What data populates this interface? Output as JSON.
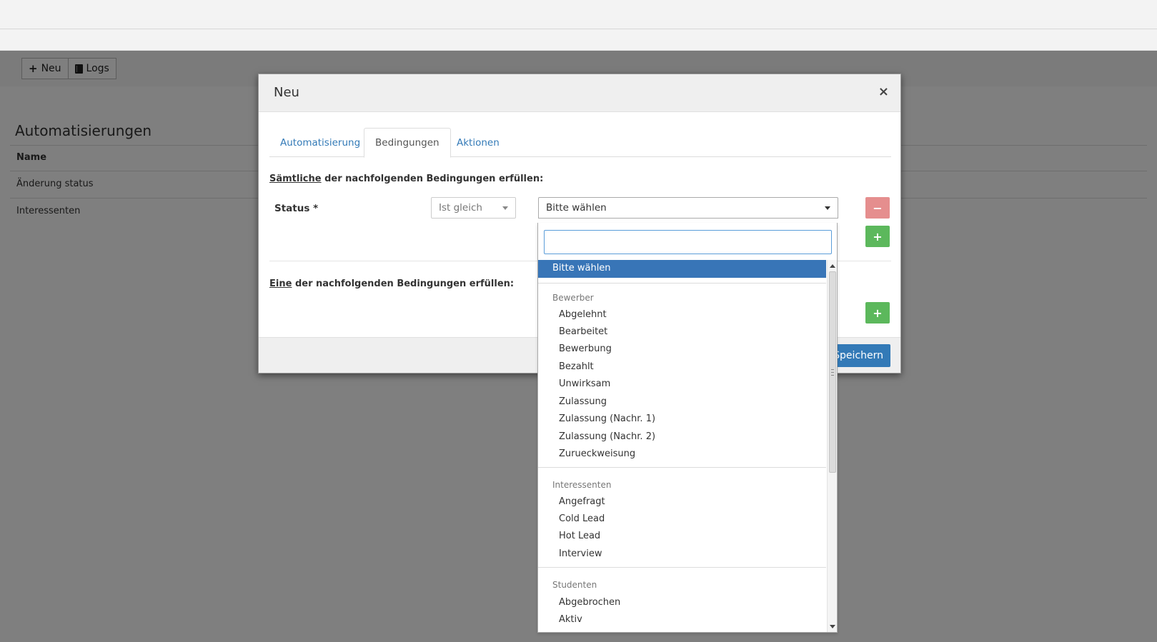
{
  "toolbar": {
    "new_label": "Neu",
    "logs_label": "Logs"
  },
  "page": {
    "title": "Automatisierungen",
    "table": {
      "header": "Name",
      "rows": [
        "Änderung status",
        "Interessenten"
      ]
    }
  },
  "modal": {
    "title": "Neu",
    "close": "×",
    "tabs": [
      {
        "label": "Automatisierung",
        "active": false
      },
      {
        "label": "Bedingungen",
        "active": true
      },
      {
        "label": "Aktionen",
        "active": false
      }
    ],
    "all_conditions": {
      "keyword": "Sämtliche",
      "text": " der nachfolgenden Bedingungen erfüllen:"
    },
    "any_conditions": {
      "keyword": "Eine",
      "text": " der nachfolgenden Bedingungen erfüllen:"
    },
    "condition": {
      "field_label": "Status *",
      "operator": "Ist gleich",
      "value": "Bitte wählen"
    },
    "remove_symbol": "−",
    "add_symbol": "+",
    "save_label": "Speichern"
  },
  "dropdown": {
    "search_value": "",
    "highlighted": "Bitte wählen",
    "groups": [
      {
        "label": "Bewerber",
        "options": [
          "Abgelehnt",
          "Bearbeitet",
          "Bewerbung",
          "Bezahlt",
          "Unwirksam",
          "Zulassung",
          "Zulassung (Nachr. 1)",
          "Zulassung (Nachr. 2)",
          "Zurueckweisung"
        ]
      },
      {
        "label": "Interessenten",
        "options": [
          "Angefragt",
          "Cold Lead",
          "Hot Lead",
          "Interview"
        ]
      },
      {
        "label": "Studenten",
        "options": [
          "Abgebrochen",
          "Aktiv"
        ]
      }
    ]
  },
  "colors": {
    "primary": "#337ab7",
    "highlight": "#3875b7",
    "success": "#5cb85c",
    "danger_light": "#e58e8e"
  }
}
